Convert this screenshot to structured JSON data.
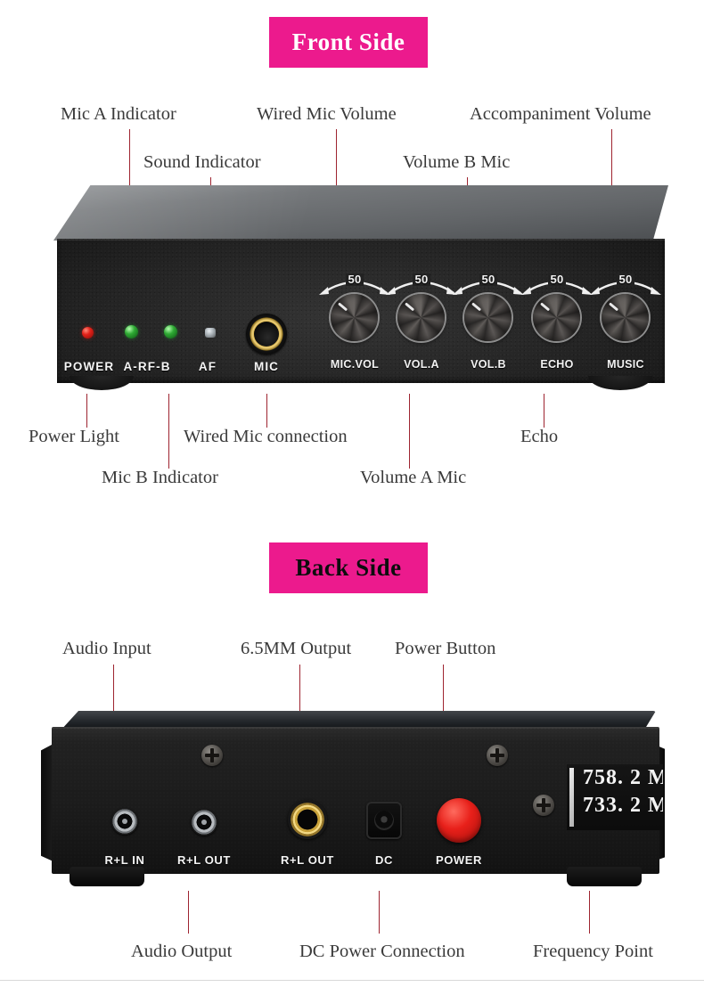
{
  "sections": {
    "front": {
      "badge": "Front Side",
      "badge_bg": "#EC1A8D",
      "badge_color": "#ffffff"
    },
    "back": {
      "badge": "Back Side",
      "badge_bg": "#EC1A8D",
      "badge_color": "#0d0d0d"
    }
  },
  "leader_color": "#9e2430",
  "front_callouts": {
    "above": [
      {
        "label": "Mic A Indicator"
      },
      {
        "label": "Sound Indicator"
      },
      {
        "label": "Wired Mic Volume"
      },
      {
        "label": "Volume B Mic"
      },
      {
        "label": "Accompaniment Volume"
      }
    ],
    "below": [
      {
        "label": "Power Light"
      },
      {
        "label": "Mic B Indicator"
      },
      {
        "label": "Wired Mic connection"
      },
      {
        "label": "Volume A Mic"
      },
      {
        "label": "Echo"
      }
    ]
  },
  "back_callouts": {
    "above": [
      {
        "label": "Audio Input"
      },
      {
        "label": "6.5MM Output"
      },
      {
        "label": "Power Button"
      }
    ],
    "below": [
      {
        "label": "Audio Output"
      },
      {
        "label": "DC Power Connection"
      },
      {
        "label": "Frequency Point"
      }
    ]
  },
  "front_panel": {
    "indicator_labels": [
      {
        "text": "POWER"
      },
      {
        "text": "A-RF-B"
      },
      {
        "text": "AF"
      },
      {
        "text": "MIC"
      }
    ],
    "knobs": [
      {
        "label": "MIC.VOL",
        "scale": "50"
      },
      {
        "label": "VOL.A",
        "scale": "50"
      },
      {
        "label": "VOL.B",
        "scale": "50"
      },
      {
        "label": "ECHO",
        "scale": "50"
      },
      {
        "label": "MUSIC",
        "scale": "50"
      }
    ]
  },
  "back_panel": {
    "port_labels": [
      {
        "text": "R+L IN"
      },
      {
        "text": "R+L OUT"
      },
      {
        "text": "R+L OUT"
      },
      {
        "text": "DC"
      },
      {
        "text": "POWER"
      }
    ],
    "display": {
      "line1": "758. 2 M",
      "line2": "733. 2 M"
    }
  }
}
